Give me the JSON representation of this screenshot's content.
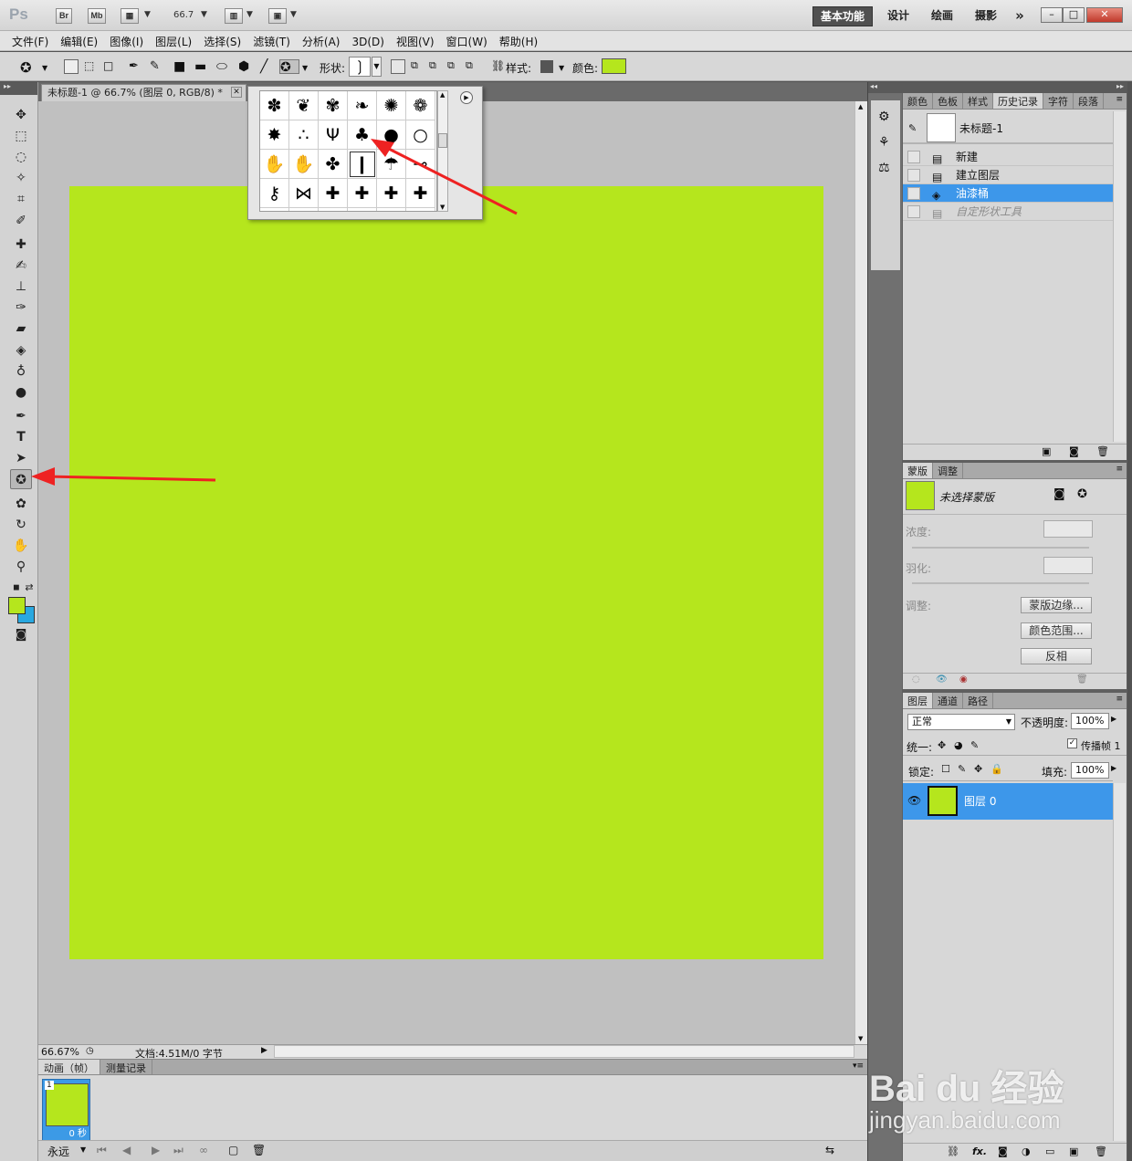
{
  "titlebar": {
    "logo": "Ps",
    "btn_br": "Br",
    "btn_mb": "Mb",
    "zoom": "66.7",
    "workspaces": [
      "基本功能",
      "设计",
      "绘画",
      "摄影"
    ],
    "more": "»"
  },
  "menu": [
    "文件(F)",
    "编辑(E)",
    "图像(I)",
    "图层(L)",
    "选择(S)",
    "滤镜(T)",
    "分析(A)",
    "3D(D)",
    "视图(V)",
    "窗口(W)",
    "帮助(H)"
  ],
  "options": {
    "shape_label": "形状:",
    "style_label": "样式:",
    "color_label": "颜色:",
    "fill_color": "#b5e61d"
  },
  "document": {
    "tab_title": "未标题-1 @ 66.7% (图层 0, RGB/8) *",
    "canvas_color": "#b5e61d",
    "zoom": "66.67%",
    "doc_info": "文档:4.51M/0 字节"
  },
  "shape_picker": {
    "shapes": [
      "✽",
      "❦",
      "✾",
      "❧",
      "✺",
      "❁",
      "✸",
      "∴",
      "Ψ",
      "♣",
      "●",
      "○",
      "✋",
      "✋",
      "✤",
      "❙",
      "☂",
      "⊸",
      "⚷",
      "⋈",
      "✚",
      "✚",
      "✚",
      "✚",
      "╲",
      "╲",
      "╲",
      "╲",
      "╲",
      "◠"
    ],
    "selected_index": 15
  },
  "animation": {
    "tabs": [
      "动画（帧）",
      "测量记录"
    ],
    "frame_number": "1",
    "frame_delay": "0 秒",
    "loop": "永远"
  },
  "history_panel": {
    "tabs": [
      "颜色",
      "色板",
      "样式",
      "历史记录",
      "字符",
      "段落"
    ],
    "snapshot": "未标题-1",
    "items": [
      "新建",
      "建立图层",
      "油漆桶",
      "自定形状工具"
    ]
  },
  "masks_panel": {
    "tabs": [
      "蒙版",
      "调整"
    ],
    "mask_label": "未选择蒙版",
    "density_label": "浓度:",
    "feather_label": "羽化:",
    "adjust_label": "调整:",
    "btn_edge": "蒙版边缘...",
    "btn_range": "颜色范围...",
    "btn_invert": "反相"
  },
  "layers_panel": {
    "tabs": [
      "图层",
      "通道",
      "路径"
    ],
    "blend_mode": "正常",
    "opacity_label": "不透明度:",
    "opacity": "100%",
    "unify_label": "统一:",
    "propagate_label": "传播帧 1",
    "lock_label": "锁定:",
    "fill_label": "填充:",
    "fill": "100%",
    "layer_name": "图层 0"
  },
  "watermark": {
    "brand": "Bai du 经验",
    "url": "jingyan.baidu.com"
  }
}
